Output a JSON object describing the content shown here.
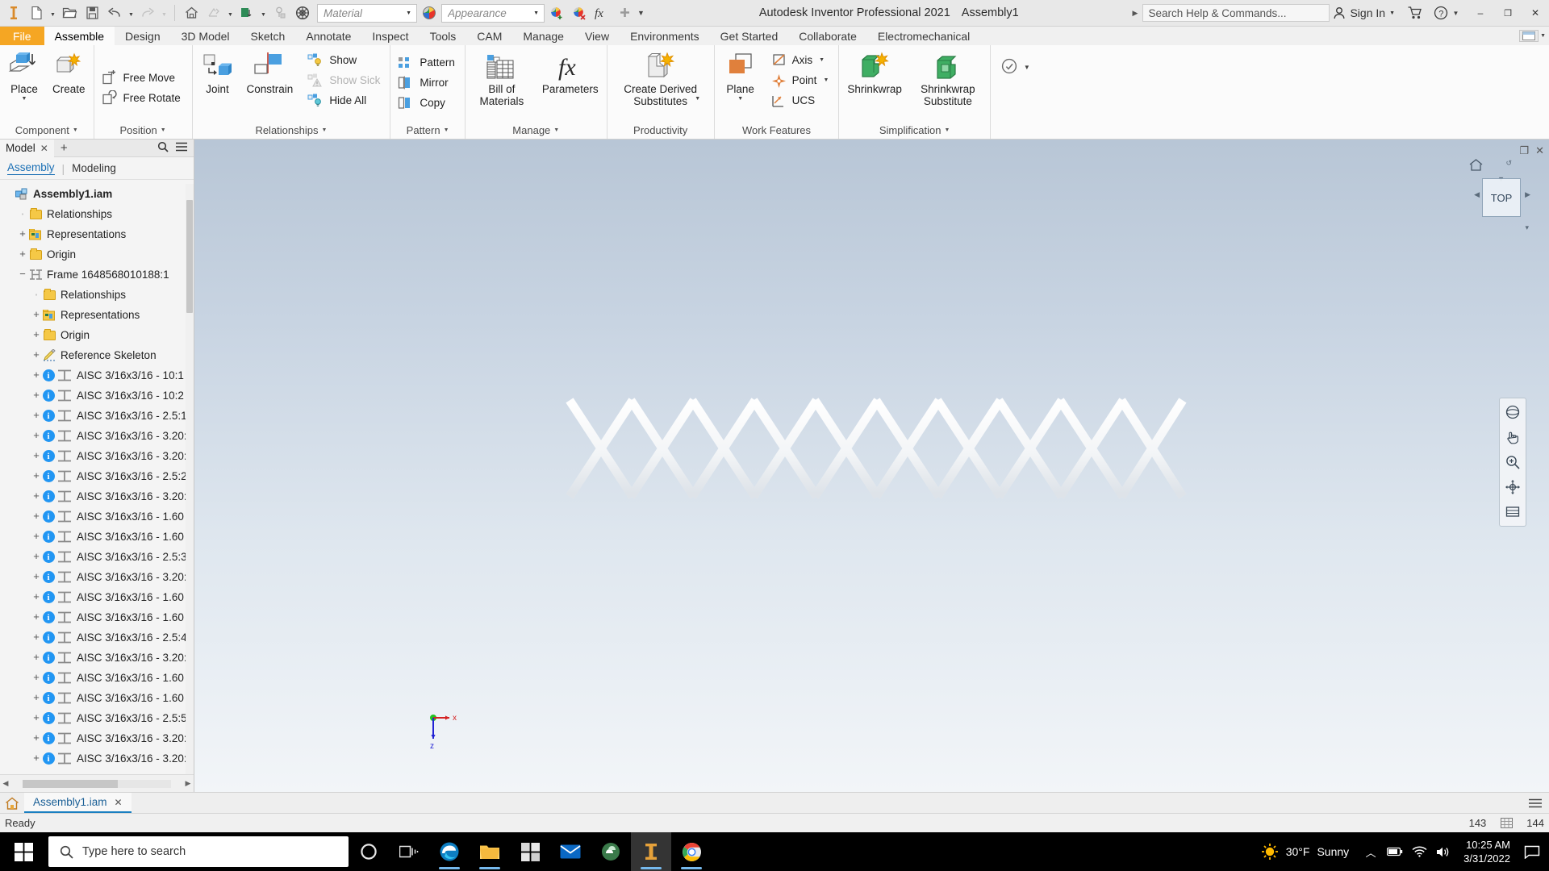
{
  "titlebar": {
    "quick_access": [
      {
        "name": "inventor-logo-icon",
        "label": "Inventor"
      },
      {
        "name": "new-file-icon",
        "label": "New"
      },
      {
        "name": "open-file-icon",
        "label": "Open"
      },
      {
        "name": "save-icon",
        "label": "Save"
      },
      {
        "name": "undo-icon",
        "label": "Undo"
      },
      {
        "name": "redo-icon",
        "label": "Redo"
      },
      {
        "name": "home-icon",
        "label": "Home"
      },
      {
        "name": "return-icon",
        "label": "Return"
      },
      {
        "name": "update-icon",
        "label": "Update"
      },
      {
        "name": "select-icon",
        "label": "Select"
      },
      {
        "name": "material-sphere-icon",
        "label": "Material Browser"
      }
    ],
    "material_value": "Material",
    "appearance_value": "Appearance",
    "app_title": "Autodesk Inventor Professional 2021",
    "document_name": "Assembly1",
    "search_placeholder": "Search Help & Commands...",
    "sign_in_label": "Sign In",
    "window_buttons": {
      "minimize": "–",
      "maximize": "❐",
      "close": "✕"
    }
  },
  "tabs": {
    "file_label": "File",
    "items": [
      "Assemble",
      "Design",
      "3D Model",
      "Sketch",
      "Annotate",
      "Inspect",
      "Tools",
      "CAM",
      "Manage",
      "View",
      "Environments",
      "Get Started",
      "Collaborate",
      "Electromechanical"
    ],
    "active": "Assemble"
  },
  "ribbon": {
    "panels": [
      {
        "label": "Component",
        "has_dropdown": true,
        "big": [
          {
            "name": "place-component-button",
            "label": "Place",
            "dropdown": true
          },
          {
            "name": "create-component-button",
            "label": "Create",
            "dropdown": false
          }
        ],
        "small": []
      },
      {
        "label": "Position",
        "has_dropdown": true,
        "big": [],
        "small": [
          {
            "name": "free-move-button",
            "label": "Free Move",
            "disabled": false
          },
          {
            "name": "free-rotate-button",
            "label": "Free Rotate",
            "disabled": false
          }
        ]
      },
      {
        "label": "Relationships",
        "has_dropdown": true,
        "big": [
          {
            "name": "joint-button",
            "label": "Joint",
            "dropdown": false
          },
          {
            "name": "constrain-button",
            "label": "Constrain",
            "dropdown": false
          }
        ],
        "small": [
          {
            "name": "show-button",
            "label": "Show",
            "disabled": false
          },
          {
            "name": "show-sick-button",
            "label": "Show Sick",
            "disabled": true
          },
          {
            "name": "hide-all-button",
            "label": "Hide All",
            "disabled": false
          }
        ]
      },
      {
        "label": "Pattern",
        "has_dropdown": true,
        "big": [],
        "small": [
          {
            "name": "pattern-button",
            "label": "Pattern",
            "disabled": false
          },
          {
            "name": "mirror-button",
            "label": "Mirror",
            "disabled": false
          },
          {
            "name": "copy-button",
            "label": "Copy",
            "disabled": false
          }
        ]
      },
      {
        "label": "Manage",
        "has_dropdown": true,
        "big": [
          {
            "name": "bill-of-materials-button",
            "label": "Bill of Materials",
            "dropdown": false
          },
          {
            "name": "parameters-button",
            "label": "Parameters",
            "dropdown": false
          }
        ],
        "small": []
      },
      {
        "label": "Productivity",
        "has_dropdown": false,
        "big": [
          {
            "name": "create-derived-substitutes-button",
            "label": "Create Derived Substitutes",
            "dropdown": true
          }
        ],
        "small": []
      },
      {
        "label": "Work Features",
        "has_dropdown": false,
        "big": [
          {
            "name": "plane-button",
            "label": "Plane",
            "dropdown": true
          }
        ],
        "small": [
          {
            "name": "axis-button",
            "label": "Axis",
            "dropdown": true,
            "disabled": false
          },
          {
            "name": "point-button",
            "label": "Point",
            "dropdown": true,
            "disabled": false
          },
          {
            "name": "ucs-button",
            "label": "UCS",
            "dropdown": false,
            "disabled": false
          }
        ]
      },
      {
        "label": "Simplification",
        "has_dropdown": true,
        "big": [
          {
            "name": "shrinkwrap-button",
            "label": "Shrinkwrap",
            "dropdown": false
          },
          {
            "name": "shrinkwrap-substitute-button",
            "label": "Shrinkwrap Substitute",
            "dropdown": false
          }
        ],
        "small": []
      },
      {
        "label": "",
        "has_dropdown": false,
        "big": [
          {
            "name": "convert-button",
            "label": "",
            "dropdown": true
          }
        ],
        "small": []
      }
    ]
  },
  "browser": {
    "tab_label": "Model",
    "tab_close": "✕",
    "add_tab": "+",
    "search_icon": "search-icon",
    "menu_icon": "menu-icon",
    "subtabs": [
      {
        "label": "Assembly",
        "active": true
      },
      {
        "label": "Modeling",
        "active": false
      }
    ],
    "tree": [
      {
        "indent": 0,
        "expander": "",
        "icon": "assembly-icon",
        "label": "Assembly1.iam",
        "bold": true
      },
      {
        "indent": 1,
        "expander": "",
        "icon": "folder",
        "label": "Relationships",
        "bold": false
      },
      {
        "indent": 1,
        "expander": "+",
        "icon": "representations-icon",
        "label": "Representations",
        "bold": false
      },
      {
        "indent": 1,
        "expander": "+",
        "icon": "folder",
        "label": "Origin",
        "bold": false
      },
      {
        "indent": 1,
        "expander": "−",
        "icon": "frame-icon",
        "label": "Frame 1648568010188:1",
        "bold": false
      },
      {
        "indent": 2,
        "expander": "",
        "icon": "folder",
        "label": "Relationships",
        "bold": false
      },
      {
        "indent": 2,
        "expander": "+",
        "icon": "representations-icon",
        "label": "Representations",
        "bold": false
      },
      {
        "indent": 2,
        "expander": "+",
        "icon": "folder",
        "label": "Origin",
        "bold": false
      },
      {
        "indent": 2,
        "expander": "+",
        "icon": "skeleton-icon",
        "label": "Reference Skeleton",
        "bold": false
      },
      {
        "indent": 2,
        "expander": "+",
        "icon": "beam-icon",
        "label": "AISC 3/16x3/16 - 10:1",
        "bold": false
      },
      {
        "indent": 2,
        "expander": "+",
        "icon": "beam-icon",
        "label": "AISC 3/16x3/16 - 10:2",
        "bold": false
      },
      {
        "indent": 2,
        "expander": "+",
        "icon": "beam-icon",
        "label": "AISC 3/16x3/16 - 2.5:1",
        "bold": false
      },
      {
        "indent": 2,
        "expander": "+",
        "icon": "beam-icon",
        "label": "AISC 3/16x3/16 - 3.20:",
        "bold": false
      },
      {
        "indent": 2,
        "expander": "+",
        "icon": "beam-icon",
        "label": "AISC 3/16x3/16 - 3.20:",
        "bold": false
      },
      {
        "indent": 2,
        "expander": "+",
        "icon": "beam-icon",
        "label": "AISC 3/16x3/16 - 2.5:2",
        "bold": false
      },
      {
        "indent": 2,
        "expander": "+",
        "icon": "beam-icon",
        "label": "AISC 3/16x3/16 - 3.20:",
        "bold": false
      },
      {
        "indent": 2,
        "expander": "+",
        "icon": "beam-icon",
        "label": "AISC 3/16x3/16 - 1.60",
        "bold": false
      },
      {
        "indent": 2,
        "expander": "+",
        "icon": "beam-icon",
        "label": "AISC 3/16x3/16 - 1.60",
        "bold": false
      },
      {
        "indent": 2,
        "expander": "+",
        "icon": "beam-icon",
        "label": "AISC 3/16x3/16 - 2.5:3",
        "bold": false
      },
      {
        "indent": 2,
        "expander": "+",
        "icon": "beam-icon",
        "label": "AISC 3/16x3/16 - 3.20:",
        "bold": false
      },
      {
        "indent": 2,
        "expander": "+",
        "icon": "beam-icon",
        "label": "AISC 3/16x3/16 - 1.60",
        "bold": false
      },
      {
        "indent": 2,
        "expander": "+",
        "icon": "beam-icon",
        "label": "AISC 3/16x3/16 - 1.60",
        "bold": false
      },
      {
        "indent": 2,
        "expander": "+",
        "icon": "beam-icon",
        "label": "AISC 3/16x3/16 - 2.5:4",
        "bold": false
      },
      {
        "indent": 2,
        "expander": "+",
        "icon": "beam-icon",
        "label": "AISC 3/16x3/16 - 3.20:",
        "bold": false
      },
      {
        "indent": 2,
        "expander": "+",
        "icon": "beam-icon",
        "label": "AISC 3/16x3/16 - 1.60",
        "bold": false
      },
      {
        "indent": 2,
        "expander": "+",
        "icon": "beam-icon",
        "label": "AISC 3/16x3/16 - 1.60",
        "bold": false
      },
      {
        "indent": 2,
        "expander": "+",
        "icon": "beam-icon",
        "label": "AISC 3/16x3/16 - 2.5:5",
        "bold": false
      },
      {
        "indent": 2,
        "expander": "+",
        "icon": "beam-icon",
        "label": "AISC 3/16x3/16 - 3.20:",
        "bold": false
      },
      {
        "indent": 2,
        "expander": "+",
        "icon": "beam-icon",
        "label": "AISC 3/16x3/16 - 3.20:",
        "bold": false
      }
    ]
  },
  "canvas": {
    "viewcube_label": "TOP",
    "axis_x_label": "x",
    "axis_z_label": "z",
    "nav_tools": [
      {
        "name": "orbit-icon"
      },
      {
        "name": "pan-hand-icon"
      },
      {
        "name": "zoom-magnifier-icon"
      },
      {
        "name": "free-orbit-icon"
      },
      {
        "name": "look-at-icon"
      }
    ]
  },
  "doctabs": {
    "home_icon": "home-icon",
    "tabs": [
      {
        "label": "Assembly1.iam",
        "close": "✕",
        "active": true
      }
    ],
    "overflow_icon": "menu-icon"
  },
  "statusbar": {
    "message": "Ready",
    "count_left": "143",
    "count_right": "144"
  },
  "taskbar": {
    "search_placeholder": "Type here to search",
    "apps": [
      {
        "name": "cortana-icon"
      },
      {
        "name": "task-view-icon"
      },
      {
        "name": "edge-icon",
        "running": true
      },
      {
        "name": "file-explorer-icon",
        "running": true
      },
      {
        "name": "microsoft-store-icon",
        "running": false
      },
      {
        "name": "mail-icon",
        "running": false
      },
      {
        "name": "anaconda-icon",
        "running": false
      },
      {
        "name": "inventor-icon",
        "running": true,
        "active": true
      },
      {
        "name": "chrome-icon",
        "running": true
      }
    ],
    "weather_temp": "30°F",
    "weather_desc": "Sunny",
    "tray_icons": [
      "chevron-up-icon",
      "battery-icon",
      "wifi-icon",
      "volume-icon"
    ],
    "time": "10:25 AM",
    "date": "3/31/2022",
    "notification_icon": "notification-icon"
  },
  "colors": {
    "file_tab": "#f5a623",
    "accent_blue": "#1a7fc1",
    "folder_yellow": "#f5c846",
    "info_blue": "#2196f3",
    "plane_orange": "#e08killed"
  }
}
